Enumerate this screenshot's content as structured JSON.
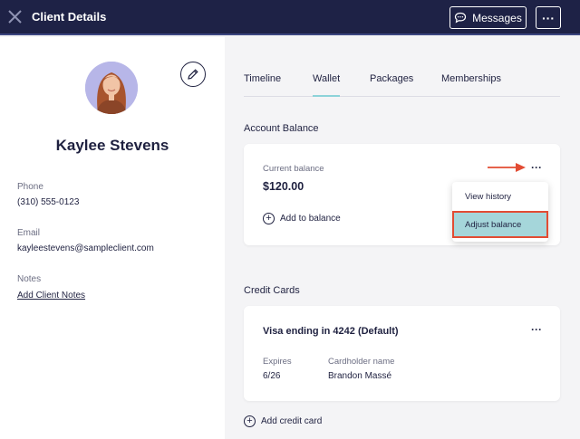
{
  "header": {
    "title": "Client Details",
    "messages_label": "Messages",
    "more_label": "···"
  },
  "client": {
    "name": "Kaylee Stevens",
    "phone_label": "Phone",
    "phone": "(310) 555-0123",
    "email_label": "Email",
    "email": "kayleestevens@sampleclient.com",
    "notes_label": "Notes",
    "notes_link": "Add Client Notes"
  },
  "tabs": [
    {
      "label": "Timeline",
      "active": false
    },
    {
      "label": "Wallet",
      "active": true
    },
    {
      "label": "Packages",
      "active": false
    },
    {
      "label": "Memberships",
      "active": false
    }
  ],
  "account": {
    "section_title": "Account Balance",
    "current_label": "Current balance",
    "current_value": "$120.00",
    "add_label": "Add to balance",
    "menu_items": [
      "View history",
      "Adjust balance"
    ]
  },
  "cards": {
    "section_title": "Credit Cards",
    "card_title": "Visa ending in 4242 (Default)",
    "expires_label": "Expires",
    "expires_value": "6/26",
    "holder_label": "Cardholder name",
    "holder_value": "Brandon Massé",
    "add_label": "Add credit card"
  },
  "colors": {
    "header_bg": "#1e2246",
    "accent_tab": "#8cd3d9",
    "highlight": "#a5d6da",
    "annotation": "#e24c33"
  },
  "icons": [
    "close-icon",
    "chat-bubble-icon",
    "more-icon",
    "pencil-icon",
    "plus-circle-icon",
    "arrow-right-icon"
  ]
}
